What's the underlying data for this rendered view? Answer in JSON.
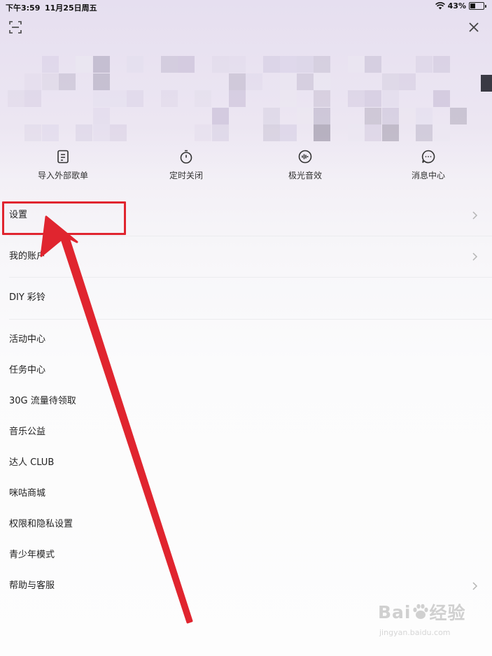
{
  "status_bar": {
    "time": "下午3:59",
    "date": "11月25日周五",
    "battery": "43%",
    "battery_level": 0.43
  },
  "quick_actions": [
    {
      "label": "导入外部歌单",
      "icon": "playlist-import-icon"
    },
    {
      "label": "定时关闭",
      "icon": "timer-icon"
    },
    {
      "label": "极光音效",
      "icon": "sound-effect-icon"
    },
    {
      "label": "消息中心",
      "icon": "message-icon"
    }
  ],
  "menu": [
    {
      "label": "设置",
      "chevron": true
    },
    {
      "label": "我的账户",
      "chevron": true
    },
    {
      "label": "DIY 彩铃",
      "chevron": false
    },
    {
      "label": "活动中心",
      "chevron": false
    },
    {
      "label": "任务中心",
      "chevron": false
    },
    {
      "label": "30G 流量待领取",
      "chevron": false
    },
    {
      "label": "音乐公益",
      "chevron": false
    },
    {
      "label": "达人 CLUB",
      "chevron": false
    },
    {
      "label": "咪咕商城",
      "chevron": false
    },
    {
      "label": "权限和隐私设置",
      "chevron": false
    },
    {
      "label": "青少年模式",
      "chevron": false
    },
    {
      "label": "帮助与客服",
      "chevron": true
    }
  ],
  "watermark": {
    "brand_prefix": "Bai",
    "brand_suffix": "经验",
    "url": "jingyan.baidu.com"
  },
  "colors": {
    "annotation": "#e0252f",
    "accent": "#e0252f"
  }
}
